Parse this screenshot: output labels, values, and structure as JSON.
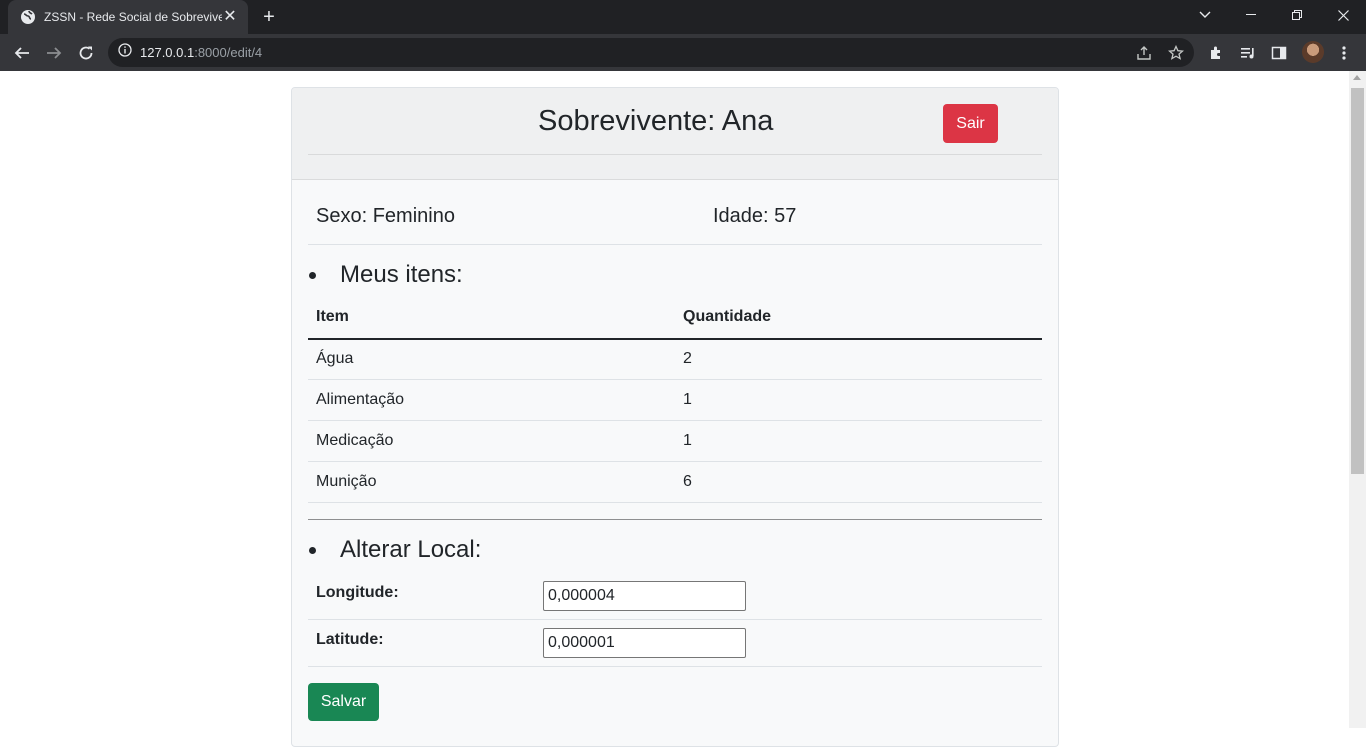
{
  "browser": {
    "tab_title": "ZSSN - Rede Social de Sobreviventes",
    "url_host": "127.0.0.1",
    "url_path": ":8000/edit/4"
  },
  "header": {
    "title": "Sobrevivente: Ana",
    "logout_label": "Sair"
  },
  "info": {
    "sexo": "Sexo: Feminino",
    "idade": "Idade: 57"
  },
  "items_section": {
    "title": "Meus itens:",
    "columns": [
      "Item",
      "Quantidade"
    ],
    "rows": [
      [
        "Água",
        "2"
      ],
      [
        "Alimentação",
        "1"
      ],
      [
        "Medicação",
        "1"
      ],
      [
        "Munição",
        "6"
      ]
    ]
  },
  "location_section": {
    "title": "Alterar Local:",
    "longitude_label": "Longitude:",
    "longitude_value": "0,000004",
    "latitude_label": "Latitude:",
    "latitude_value": "0,000001",
    "save_label": "Salvar"
  },
  "colors": {
    "danger": "#dc3545",
    "success": "#198754"
  }
}
